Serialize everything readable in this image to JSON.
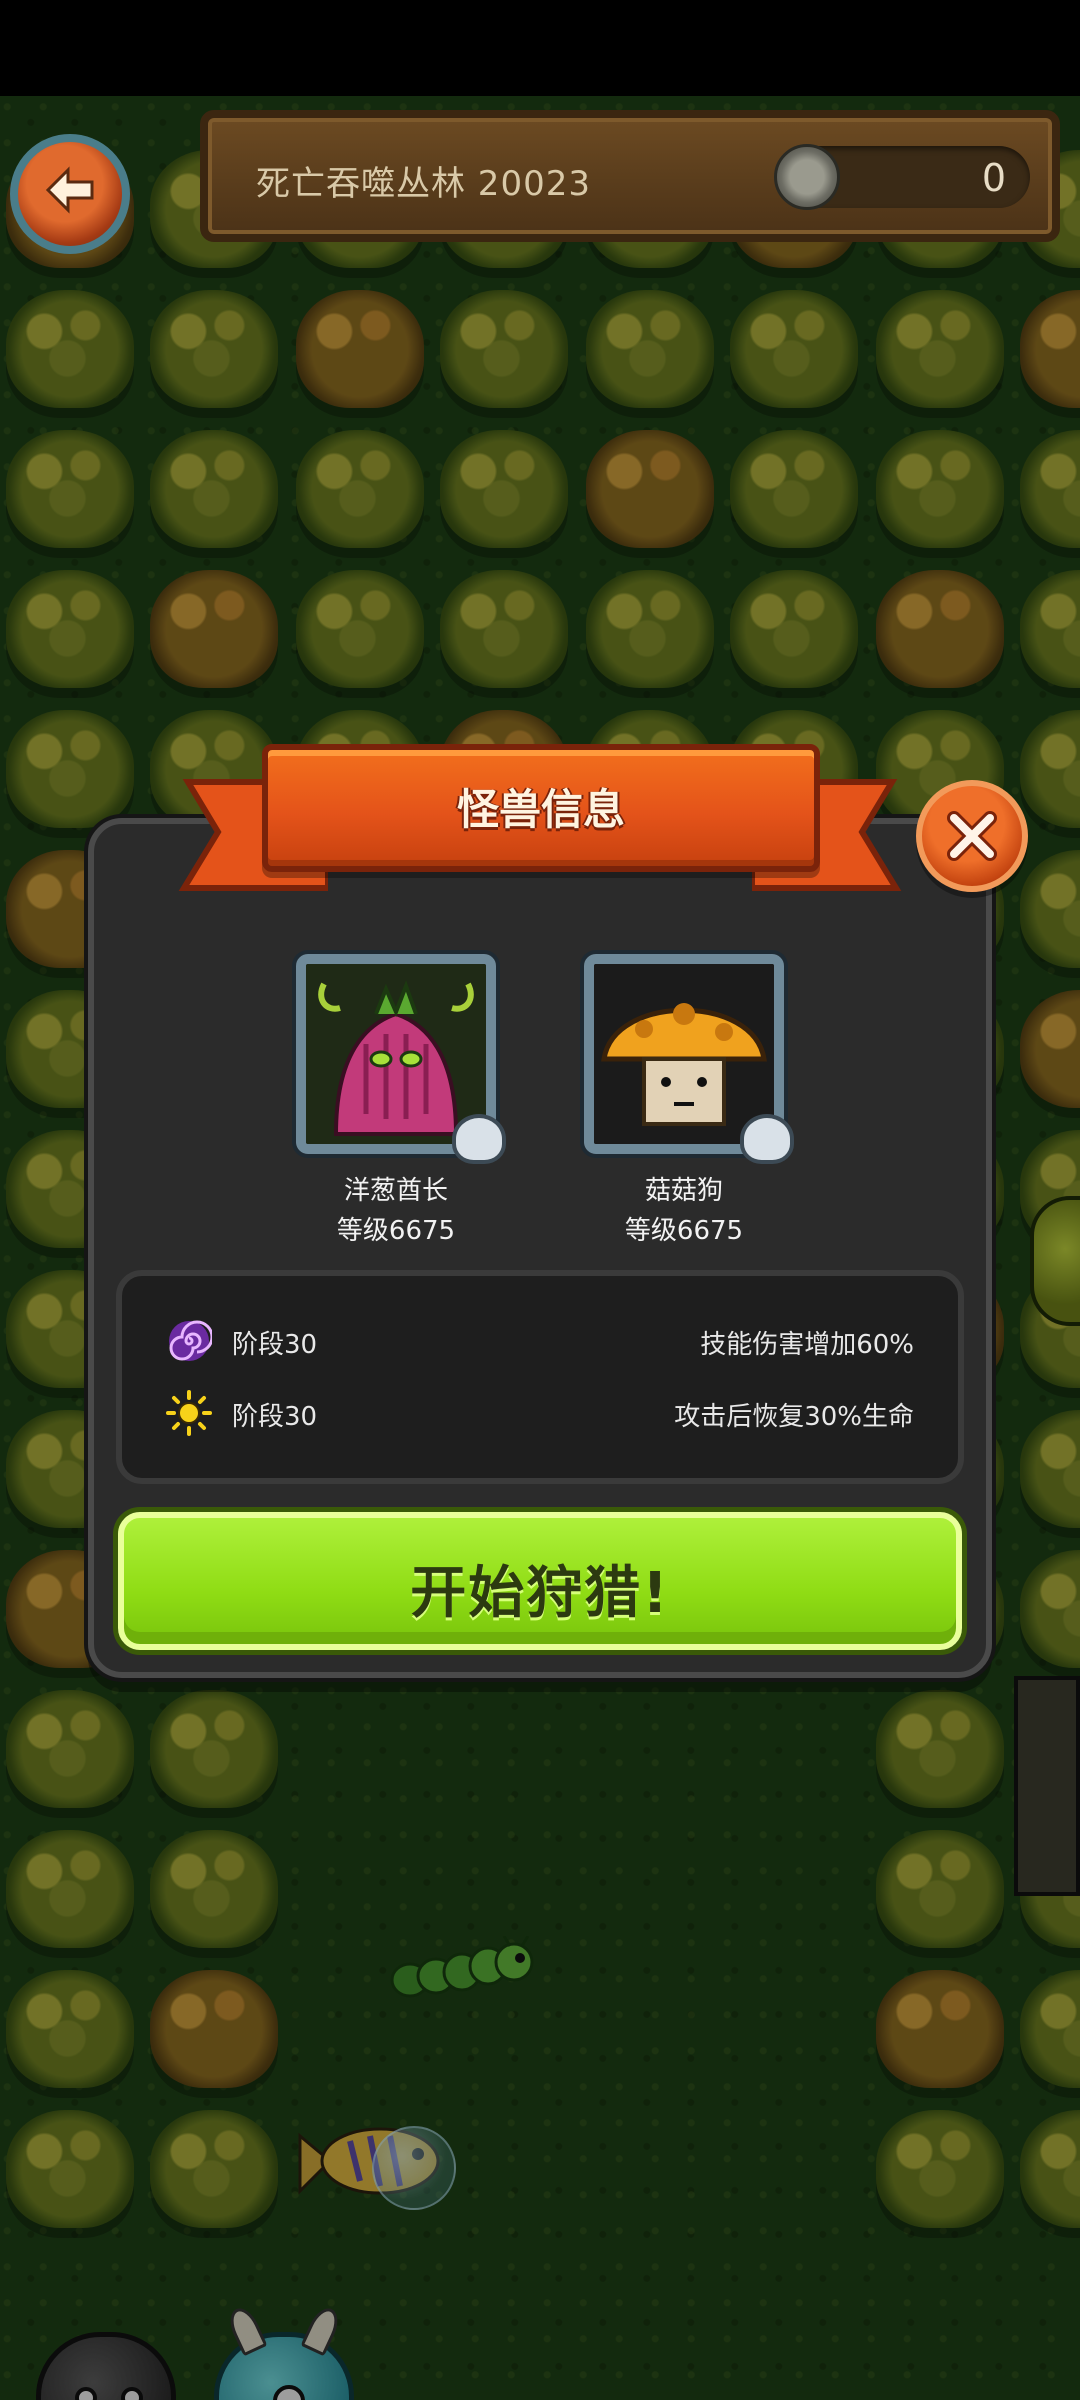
{
  "hud": {
    "level_name": "死亡吞噬丛林 20023",
    "coin_count": "0"
  },
  "modal": {
    "title": "怪兽信息",
    "monsters": [
      {
        "name": "洋葱酋长",
        "level": "等级6675"
      },
      {
        "name": "菇菇狗",
        "level": "等级6675"
      }
    ],
    "stages": [
      {
        "icon": "purple-swirl-icon",
        "label": "阶段30",
        "effect": "技能伤害增加60%"
      },
      {
        "icon": "sun-icon",
        "label": "阶段30",
        "effect": "攻击后恢复30%生命"
      }
    ],
    "hunt_button": "开始狩猎!"
  },
  "colors": {
    "ribbon": "#e4531a",
    "hunt_button": "#8fdc14",
    "modal_bg": "#2b2b2b"
  }
}
